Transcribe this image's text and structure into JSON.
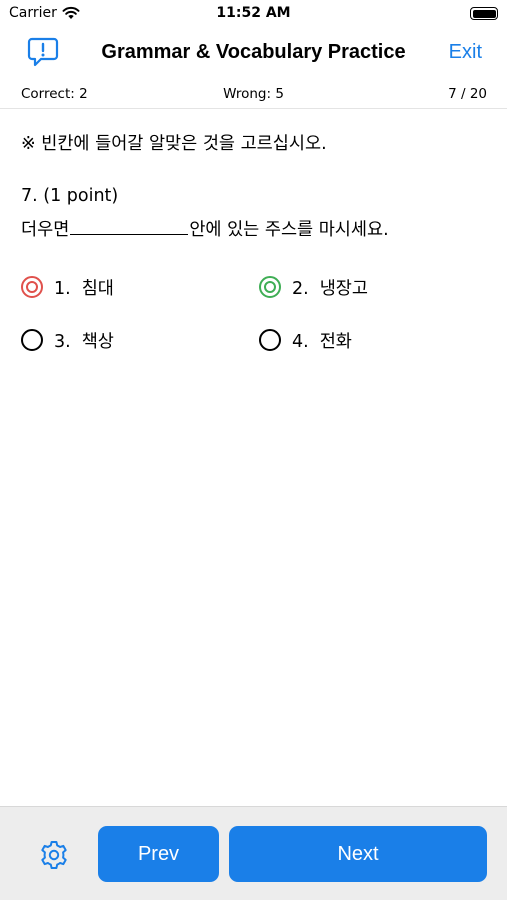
{
  "status_bar": {
    "carrier": "Carrier",
    "time": "11:52 AM"
  },
  "nav": {
    "title": "Grammar & Vocabulary Practice",
    "exit_label": "Exit"
  },
  "score": {
    "correct": "Correct: 2",
    "wrong": "Wrong: 5",
    "progress": "7 / 20"
  },
  "question": {
    "instruction": "※ 빈칸에 들어갈 알맞은 것을 고르십시오.",
    "number": "7.   (1 point)",
    "text_before": "더우면",
    "text_after": "안에 있는 주스를 마시세요.",
    "options": [
      {
        "num": "1.",
        "text": "침대",
        "state": "wrong-selected"
      },
      {
        "num": "2.",
        "text": "냉장고",
        "state": "correct-answer"
      },
      {
        "num": "3.",
        "text": "책상",
        "state": "unselected"
      },
      {
        "num": "4.",
        "text": "전화",
        "state": "unselected"
      }
    ]
  },
  "footer": {
    "prev_label": "Prev",
    "next_label": "Next"
  },
  "colors": {
    "accent": "#1a7fe8",
    "wrong": "#e0514c",
    "correct": "#3fae55"
  },
  "icons": {
    "feedback": "exclamation-bubble-icon",
    "settings": "gear-icon"
  }
}
